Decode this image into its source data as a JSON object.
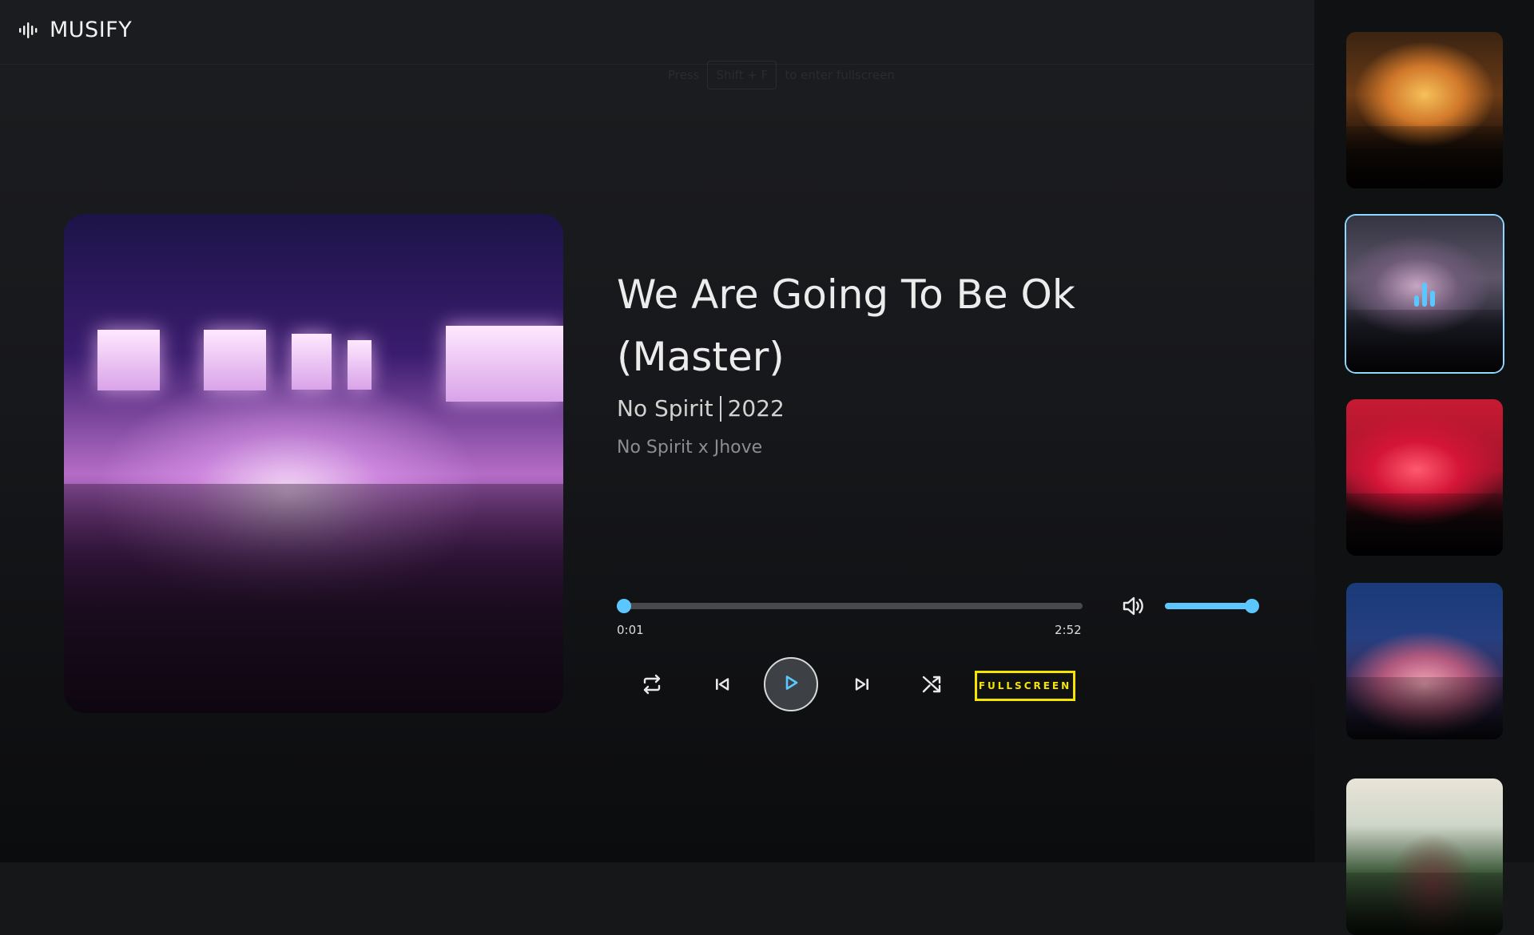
{
  "app": {
    "name": "MUSIFY",
    "logo_icon": "waveform-icon"
  },
  "hint": {
    "press": "Press",
    "key": "Shift + F",
    "action": "to enter fullscreen"
  },
  "now_playing": {
    "title": "We Are Going To Be Ok (Master)",
    "artist": "No Spirit",
    "year": "2022",
    "artists": "No Spirit x Jhove",
    "current_time": "0:01",
    "duration": "2:52",
    "progress": 0.006,
    "volume": 0.9
  },
  "controls": {
    "repeat_icon": "repeat-icon",
    "previous_icon": "skip-previous-icon",
    "play_icon": "play-icon",
    "next_icon": "skip-next-icon",
    "shuffle_icon": "shuffle-icon",
    "volume_icon": "volume-icon",
    "fullscreen_label": "FULLSCREEN"
  },
  "playlist": {
    "active_index": 1,
    "items": [
      {
        "thumbnail": "concert-orange-lights"
      },
      {
        "thumbnail": "concert-stage-screens"
      },
      {
        "thumbnail": "concert-red-smoke"
      },
      {
        "thumbnail": "concert-crowd-blue"
      },
      {
        "thumbnail": "concert-performer"
      }
    ]
  },
  "colors": {
    "accent": "#5cc7ff",
    "fullscreen_border": "#f5e400",
    "background": "#161719"
  }
}
